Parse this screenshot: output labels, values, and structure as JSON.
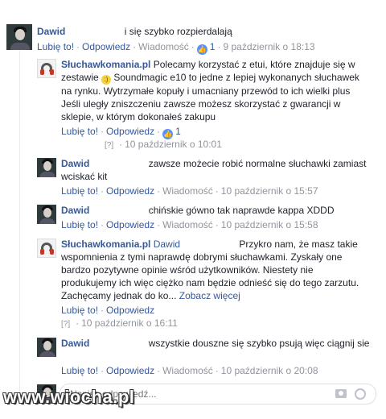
{
  "actions": {
    "like": "Lubię to!",
    "reply": "Odpowiedz",
    "message": "Wiadomość",
    "sep": "·",
    "edited_mark": "[?]"
  },
  "comments": [
    {
      "author": "Dawid",
      "text": "i się szybko rozpierdalają",
      "likes": "1",
      "date": "9 październik o 18:13"
    },
    {
      "author": "Słuchawkomania.pl",
      "text_before": "Polecamy korzystać z etui, które znajduje się w zestawie ",
      "smiley": ":)",
      "text_after": " Soundmagic e10 to jedne z lepiej wykonanych słuchawek na rynku. Wytrzymałe kopuły i umacniany przewód to ich wielki plus Jeśli uległy zniszczeniu zawsze możesz skorzystać z gwarancji w sklepie, w którym dokonałeś zakupu",
      "likes": "1",
      "date": "10 październik o 10:01"
    },
    {
      "author": "Dawid",
      "text": "zawsze możecie robić normalne słuchawki zamiast wciskać kit",
      "date": "10 październik o 15:57"
    },
    {
      "author": "Dawid",
      "text": "chińskie gówno tak naprawde kappa XDDD",
      "date": "10 październik o 15:58"
    },
    {
      "author": "Słuchawkomania.pl",
      "mention": "Dawid",
      "text": "Przykro nam, że masz takie wspomnienia z tymi naprawdę dobrymi słuchawkami. Zyskały one bardzo pozytywne opinie wśród użytkowników. Niestety nie produkujemy ich więc ciężko nam będzie odnieść się do tego zarzutu. Zachęcamy jednak do ko... ",
      "see_more": "Zobacz więcej",
      "date": "10 październik o 16:11"
    },
    {
      "author": "Dawid",
      "text": "wszystkie douszne się szybko psują więc ciągnij sie",
      "date": "10 październik o 20:08"
    }
  ],
  "reply_box": {
    "placeholder": "Napisz odpowiedź..."
  },
  "watermark": "www.wiocha.pl"
}
